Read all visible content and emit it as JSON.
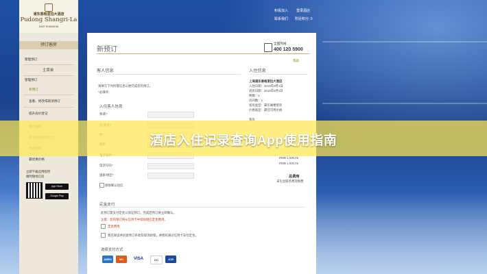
{
  "header": {
    "links": [
      "积极加入",
      "登录酒店",
      "联系我们",
      "附近积分: 0"
    ]
  },
  "logo": {
    "cn": "浦东香格里拉大酒店",
    "en": "Pudong Shangri-La",
    "sub": "EAST SHANGHAI"
  },
  "sidebar": {
    "head1": "预订客房",
    "group1_item": "管理预订",
    "head2": "主菜单",
    "group2_title": "管理预订",
    "items": [
      {
        "label": "新预订",
        "state": "active"
      },
      {
        "label": "查看、修改或取消预订",
        "state": "normal"
      },
      {
        "label": "提升房价登记",
        "state": "normal"
      },
      {
        "label": "特价推荐",
        "state": "dim"
      },
      {
        "label": "紧急修改信息告示",
        "state": "dim"
      },
      {
        "label": "优惠项目",
        "state": "dim"
      },
      {
        "label": "最优惠价格",
        "state": "normal"
      }
    ],
    "app_promo_1": "立即下载应用程序",
    "app_promo_2": "随时随地订房",
    "store_buttons": [
      "App Store",
      "Google Play"
    ]
  },
  "panel": {
    "title": "新预订",
    "phone_label": "全国热线",
    "phone_number": "400 120 5900",
    "help_link": "帮助",
    "guest_section": "客人信息",
    "guest_note": "请填写下列所需信息以便完成您的预订。",
    "required_note": "*必填项",
    "guest_sub": "入住客人信息",
    "fields": [
      "称谓:*",
      "名(英文)*",
      "姓*",
      "国家",
      "电子邮件*",
      "电话号码*",
      "国家/地区*"
    ],
    "reminder": "接收确认短信",
    "stay_section": "入住信息",
    "hotel_name": "上海浦东香格里拉大酒店",
    "checkin": "入住日期：2019年9月1日",
    "checkout": "退房日期：2019年9月2日",
    "nights": "晚数：1",
    "rooms": "房间数：1",
    "room_type": "客房类型：豪华阁楼客房",
    "rate_type": "价格类型：最佳可用价格",
    "price_label": "客房",
    "price_line_1": "RMB 1,836.45",
    "price_line_2": "RMB 1,836.45",
    "total_label": "总费用",
    "total_note": "未包含服务费及税费",
    "deposit_section": "定金支付",
    "deposit_note": "此预订需支付定金以保证预订。完成后预订将立即确认。",
    "deposit_warning": "注意：您的预订将从信用卡中扣除相应定金费用。",
    "deposit_option": "定金费用",
    "agree_text": "我已阅读并同意预订条款及取消政策，并授权通过信用卡支付定金。",
    "payment_section": "选择支付方式",
    "cards": [
      "AMEX",
      "MC",
      "VISA",
      "DC",
      "JCB"
    ]
  },
  "overlay": {
    "banner": "酒店入住记录查询App使用指南"
  },
  "colors": {
    "gold": "#a07a1c",
    "banner": "#ffe850",
    "sidebar": "#efe9dd"
  }
}
